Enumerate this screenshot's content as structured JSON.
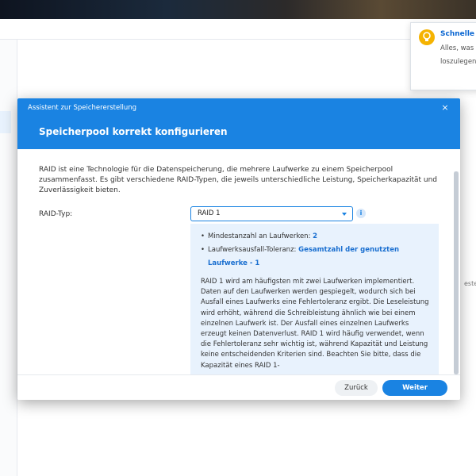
{
  "notification": {
    "title": "Schnelle",
    "line1": "Alles, was",
    "line2": "loszulegen"
  },
  "background": {
    "partial_text": "este"
  },
  "dialog": {
    "window_title": "Assistent zur Speichererstellung",
    "close_glyph": "×",
    "title": "Speicherpool korrekt konfigurieren",
    "intro": "RAID ist eine Technologie für die Datenspeicherung, die mehrere Laufwerke zu einem Speicherpool zusammenfasst. Es gibt verschiedene RAID-Typen, die jeweils unterschiedliche Leistung, Speicherkapazität und Zuverlässigkeit bieten.",
    "raid_label": "RAID-Typ:",
    "raid_value": "RAID 1",
    "info_glyph": "i",
    "info": {
      "min_drives_label": "Mindestanzahl an Laufwerken: ",
      "min_drives_value": "2",
      "tolerance_label": "Laufwerksausfall-Toleranz: ",
      "tolerance_value": "Gesamtzahl der genutzten Laufwerke - 1",
      "description": "RAID 1 wird am häufigsten mit zwei Laufwerken implementiert. Daten auf den Laufwerken werden gespiegelt, wodurch sich bei Ausfall eines Laufwerks eine Fehlertoleranz ergibt. Die Leseleistung wird erhöht, während die Schreibleistung ähnlich wie bei einem einzelnen Laufwerk ist. Der Ausfall eines einzelnen Laufwerks erzeugt keinen Datenverlust. RAID 1 wird häufig verwendet, wenn die Fehlertoleranz sehr wichtig ist, während Kapazität und Leistung keine entscheidenden Kriterien sind. Beachten Sie bitte, dass die Kapazität eines RAID 1-"
    },
    "back_label": "Zurück",
    "next_label": "Weiter"
  },
  "colors": {
    "accent": "#1a83e2",
    "info_bg": "#e8f2fd",
    "notif_icon": "#f5b301"
  },
  "icons": [
    "lightbulb-icon",
    "close-icon",
    "chevron-down-icon",
    "info-icon"
  ]
}
